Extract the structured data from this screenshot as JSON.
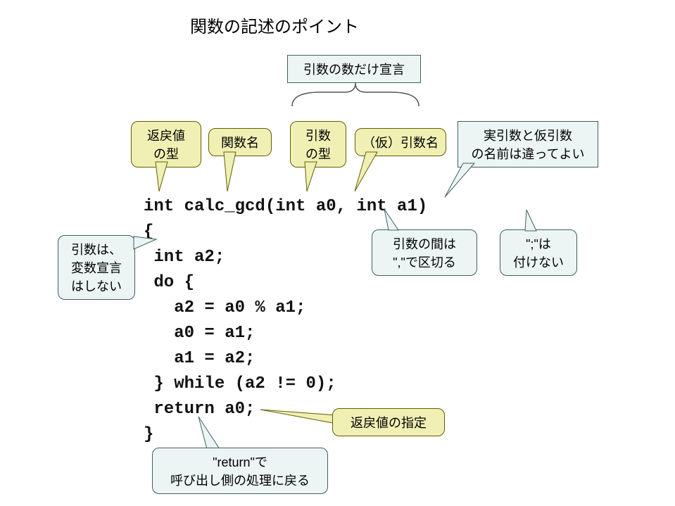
{
  "title": "関数の記述のポイント",
  "header_box": "引数の数だけ宣言",
  "callouts": {
    "return_type": "返戻値\nの型",
    "func_name": "関数名",
    "arg_type": "引数\nの型",
    "arg_name": "（仮）引数名",
    "real_vs_formal": "実引数と仮引数\nの名前は違ってよい",
    "no_decl": "引数は、\n変数宣言\nはしない",
    "comma": "引数の間は\n\",\"で区切る",
    "no_semi": "\";\"は\n付けない",
    "return_val": "返戻値の指定",
    "return_flow": "\"return\"で\n呼び出し側の処理に戻る"
  },
  "code_lines": [
    "int calc_gcd(int a0, int a1)",
    "{",
    " int a2;",
    " do {",
    "   a2 = a0 % a1;",
    "   a0 = a1;",
    "   a1 = a2;",
    " } while (a2 != 0);",
    " return a0;",
    "}"
  ]
}
